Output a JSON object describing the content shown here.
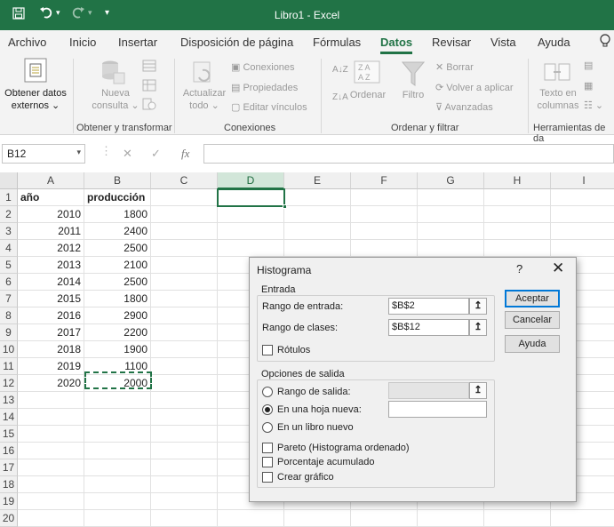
{
  "window": {
    "title": "Libro1  -  Excel"
  },
  "quick_access": {
    "save_icon": "save-icon",
    "undo_icon": "undo-icon",
    "redo_icon": "redo-icon",
    "customize_icon": "customize-icon"
  },
  "tabs": [
    "Archivo",
    "Inicio",
    "Insertar",
    "Disposición de página",
    "Fórmulas",
    "Datos",
    "Revisar",
    "Vista",
    "Ayuda"
  ],
  "active_tab": "Datos",
  "ribbon": {
    "get_external": "Obtener datos",
    "get_external2": "externos",
    "new_query": "Nueva",
    "new_query2": "consulta",
    "group1": "Obtener y transformar",
    "refresh": "Actualizar",
    "refresh2": "todo",
    "connections": "Conexiones",
    "properties": "Propiedades",
    "edit_links": "Editar vínculos",
    "group2": "Conexiones",
    "sort": "Ordenar",
    "filter": "Filtro",
    "clear": "Borrar",
    "reapply": "Volver a aplicar",
    "advanced": "Avanzadas",
    "group3": "Ordenar y filtrar",
    "text_to_columns": "Texto en",
    "text_to_columns2": "columnas",
    "group4": "Herramientas de da"
  },
  "formula_bar": {
    "name_box": "B12",
    "fx": "fx",
    "cancel": "✕",
    "enter": "✓"
  },
  "sheet": {
    "columns": [
      "A",
      "B",
      "C",
      "D",
      "E",
      "F",
      "G",
      "H",
      "I"
    ],
    "rows": [
      "1",
      "2",
      "3",
      "4",
      "5",
      "6",
      "7",
      "8",
      "9",
      "10",
      "11",
      "12",
      "13",
      "14",
      "15",
      "16",
      "17",
      "18",
      "19",
      "20"
    ],
    "header_a": "año",
    "header_b": "producción",
    "data": [
      [
        "2010",
        "1800"
      ],
      [
        "2011",
        "2400"
      ],
      [
        "2012",
        "2500"
      ],
      [
        "2013",
        "2100"
      ],
      [
        "2014",
        "2500"
      ],
      [
        "2015",
        "1800"
      ],
      [
        "2016",
        "2900"
      ],
      [
        "2017",
        "2200"
      ],
      [
        "2018",
        "1900"
      ],
      [
        "2019",
        "1100"
      ],
      [
        "2020",
        "2000"
      ]
    ]
  },
  "dialog": {
    "title": "Histograma",
    "help": "?",
    "close": "✕",
    "input_group": "Entrada",
    "input_range_label": "Rango de entrada:",
    "input_range_value": "$B$2",
    "bin_range_label": "Rango de clases:",
    "bin_range_value": "$B$12",
    "labels_label": "Rótulos",
    "output_group": "Opciones de salida",
    "output_range_label": "Rango de salida:",
    "new_sheet_label": "En una hoja nueva:",
    "new_book_label": "En un libro nuevo",
    "pareto_label": "Pareto (Histograma ordenado)",
    "cumulative_label": "Porcentaje acumulado",
    "chart_label": "Crear gráfico",
    "ok": "Aceptar",
    "cancel": "Cancelar",
    "help_btn": "Ayuda",
    "ref_icon": "↥"
  }
}
